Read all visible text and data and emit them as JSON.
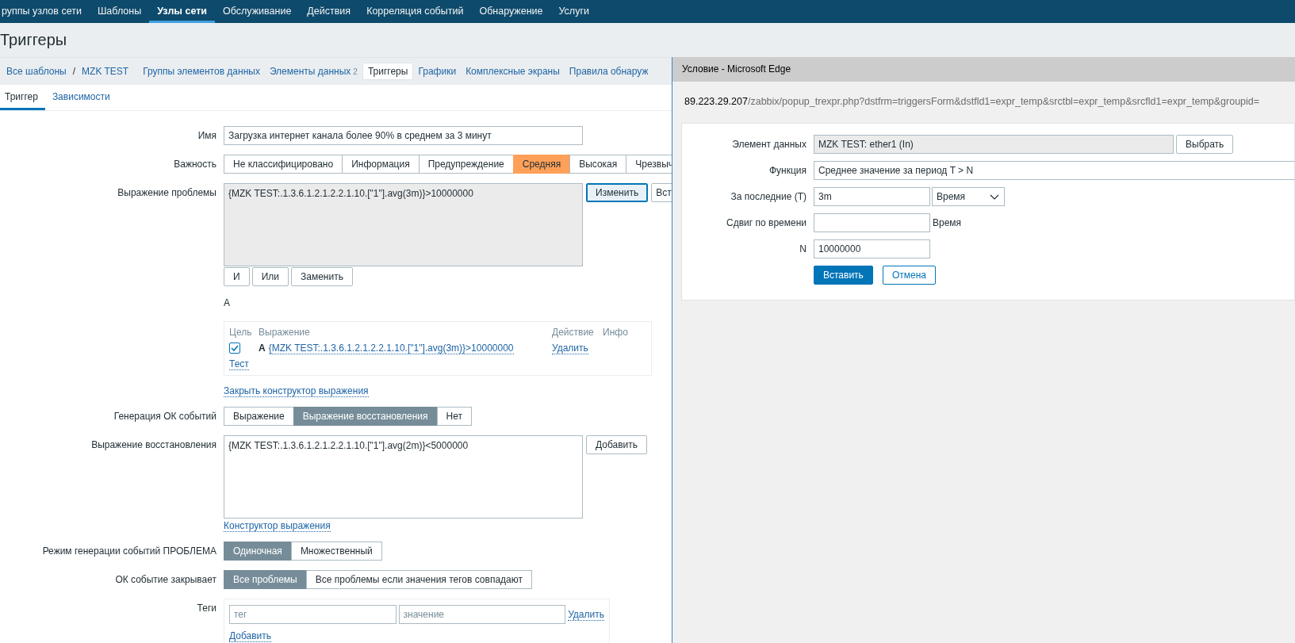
{
  "top_nav": [
    {
      "label": "руппы узлов сети",
      "selected": false
    },
    {
      "label": "Шаблоны",
      "selected": false
    },
    {
      "label": "Узлы сети",
      "selected": true
    },
    {
      "label": "Обслуживание",
      "selected": false
    },
    {
      "label": "Действия",
      "selected": false
    },
    {
      "label": "Корреляция событий",
      "selected": false
    },
    {
      "label": "Обнаружение",
      "selected": false
    },
    {
      "label": "Услуги",
      "selected": false
    }
  ],
  "page_title": "Триггеры",
  "host_path": {
    "root": "Все шаблоны",
    "separator": "/",
    "host": "MZK TEST"
  },
  "sub_nav": [
    {
      "label": "Группы элементов данных",
      "selected": false
    },
    {
      "label": "Элементы данных",
      "count": "2",
      "selected": false
    },
    {
      "label": "Триггеры",
      "selected": true
    },
    {
      "label": "Графики",
      "selected": false
    },
    {
      "label": "Комплексные экраны",
      "selected": false
    },
    {
      "label": "Правила обнаруж",
      "selected": false
    }
  ],
  "form_tabs": [
    {
      "label": "Триггер",
      "selected": true
    },
    {
      "label": "Зависимости",
      "selected": false
    }
  ],
  "name": {
    "label": "Имя",
    "value": "Загрузка интернет канала более 90% в среднем за 3 минут"
  },
  "severity": {
    "label": "Важность",
    "options": [
      {
        "label": "Не классифицировано",
        "selected": false
      },
      {
        "label": "Информация",
        "selected": false
      },
      {
        "label": "Предупреждение",
        "selected": false
      },
      {
        "label": "Средняя",
        "selected": true
      },
      {
        "label": "Высокая",
        "selected": false
      },
      {
        "label": "Чрезвыч",
        "selected": false
      }
    ]
  },
  "problem_expression": {
    "label": "Выражение проблемы",
    "value": "{MZK TEST:.1.3.6.1.2.1.2.2.1.10.[\"1\"].avg(3m)}>10000000",
    "readonly": true,
    "buttons": [
      {
        "label": "Изменить",
        "focused": true
      },
      {
        "label": "Вст",
        "focused": false
      }
    ],
    "logic_buttons": [
      "И",
      "Или",
      "Заменить"
    ],
    "result": "A"
  },
  "expression_table": {
    "columns": [
      "Цель",
      "Выражение",
      "Действие",
      "Инфо"
    ],
    "rows": [
      {
        "checked": true,
        "id": "A",
        "expression": "{MZK TEST:.1.3.6.1.2.1.2.2.1.10.[\"1\"].avg(3m)}>10000000",
        "action": "Удалить"
      }
    ],
    "test_link": "Тест"
  },
  "close_builder_link": "Закрыть конструктор выражения",
  "ok_event_generation": {
    "label": "Генерация ОК событий",
    "options": [
      {
        "label": "Выражение",
        "selected": false
      },
      {
        "label": "Выражение восстановления",
        "selected": true
      },
      {
        "label": "Нет",
        "selected": false
      }
    ]
  },
  "recovery_expression": {
    "label": "Выражение восстановления",
    "value": "{MZK TEST:.1.3.6.1.2.1.2.2.1.10.[\"1\"].avg(2m)}<5000000",
    "button": "Добавить",
    "builder_link": "Конструктор выражения"
  },
  "problem_event_mode": {
    "label": "Режим генерации событий ПРОБЛЕМА",
    "options": [
      {
        "label": "Одиночная",
        "selected": true
      },
      {
        "label": "Множественный",
        "selected": false
      }
    ]
  },
  "ok_event_closes": {
    "label": "ОК событие закрывает",
    "options": [
      {
        "label": "Все проблемы",
        "selected": true
      },
      {
        "label": "Все проблемы если значения тегов совпадают",
        "selected": false
      }
    ]
  },
  "tags": {
    "label": "Теги",
    "rows": [
      {
        "tag_placeholder": "тег",
        "value_placeholder": "значение",
        "remove": "Удалить"
      }
    ],
    "add": "Добавить"
  },
  "popup": {
    "title": "Условие - Microsoft Edge",
    "url_host": "89.223.29.207",
    "url_path": "/zabbix/popup_trexpr.php?dstfrm=triggersForm&dstfld1=expr_temp&srctbl=expr_temp&srcfld1=expr_temp&groupid=",
    "fields": [
      {
        "kind": "readonly",
        "label": "Элемент данных",
        "value": "MZK TEST: ether1 (In)",
        "button": "Выбрать"
      },
      {
        "kind": "select",
        "label": "Функция",
        "value": "Среднее значение за период T > N"
      },
      {
        "kind": "input_select",
        "label": "За последние (T)",
        "value": "3m",
        "unit": "Время"
      },
      {
        "kind": "input_suffix",
        "label": "Сдвиг по времени",
        "suffix": "Время"
      },
      {
        "kind": "input",
        "label": "N",
        "value": "10000000"
      }
    ],
    "buttons": [
      {
        "label": "Вставить",
        "kind": "primary"
      },
      {
        "label": "Отмена",
        "kind": "secondary"
      }
    ]
  }
}
